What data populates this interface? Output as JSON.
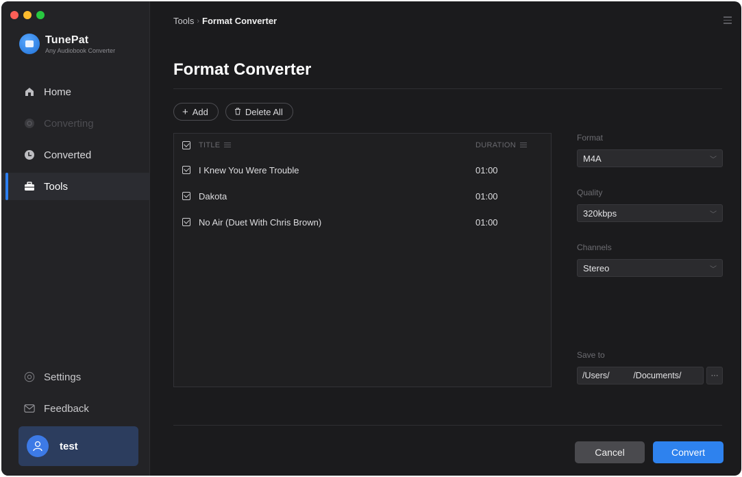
{
  "brand": {
    "name": "TunePat",
    "subtitle": "Any Audiobook Converter"
  },
  "sidebar": {
    "items": [
      {
        "label": "Home",
        "icon": "home-icon",
        "state": "normal"
      },
      {
        "label": "Converting",
        "icon": "converting-icon",
        "state": "disabled"
      },
      {
        "label": "Converted",
        "icon": "clock-icon",
        "state": "normal"
      },
      {
        "label": "Tools",
        "icon": "toolbox-icon",
        "state": "active"
      }
    ],
    "bottom_items": [
      {
        "label": "Settings",
        "icon": "gear-icon"
      },
      {
        "label": "Feedback",
        "icon": "mail-icon"
      }
    ],
    "user": {
      "name": "test",
      "icon": "user-icon"
    }
  },
  "breadcrumb": {
    "parent": "Tools",
    "separator": "›",
    "current": "Format Converter"
  },
  "page_title": "Format Converter",
  "toolbar": {
    "add_label": "Add",
    "delete_all_label": "Delete All"
  },
  "table": {
    "headers": {
      "title": "TITLE",
      "duration": "DURATION"
    },
    "rows": [
      {
        "title": "I Knew You Were Trouble",
        "duration": "01:00",
        "checked": true
      },
      {
        "title": "Dakota",
        "duration": "01:00",
        "checked": true
      },
      {
        "title": "No Air (Duet With Chris Brown)",
        "duration": "01:00",
        "checked": true
      }
    ]
  },
  "settings": {
    "format": {
      "label": "Format",
      "value": "M4A"
    },
    "quality": {
      "label": "Quality",
      "value": "320kbps"
    },
    "channels": {
      "label": "Channels",
      "value": "Stereo"
    },
    "save_to": {
      "label": "Save to",
      "value": "/Users/          /Documents/",
      "browse_label": "···"
    }
  },
  "actions": {
    "cancel_label": "Cancel",
    "convert_label": "Convert"
  },
  "colors": {
    "accent": "#2e82ee",
    "sidebar_bg": "#232326",
    "main_bg": "#1b1b1d",
    "user_card": "#2c3d5e"
  }
}
